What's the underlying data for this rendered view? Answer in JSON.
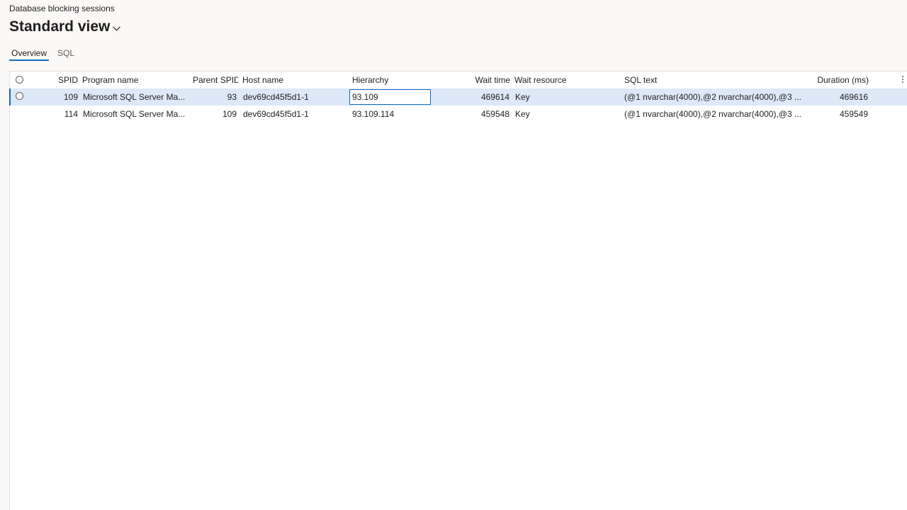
{
  "page": {
    "caption": "Database blocking sessions",
    "view_title": "Standard view"
  },
  "tabs": [
    {
      "label": "Overview",
      "active": true
    },
    {
      "label": "SQL",
      "active": false
    }
  ],
  "grid": {
    "columns": {
      "spid": "SPID",
      "program_name": "Program name",
      "parent_spid": "Parent SPID",
      "host_name": "Host name",
      "hierarchy": "Hierarchy",
      "wait_time": "Wait time",
      "wait_resource": "Wait resource",
      "sql_text": "SQL text",
      "duration": "Duration (ms)"
    },
    "rows": [
      {
        "selected": true,
        "spid": "109",
        "program_name": "Microsoft SQL Server Ma...",
        "parent_spid": "93",
        "host_name": "dev69cd45f5d1-1",
        "hierarchy": "93.109",
        "wait_time": "469614",
        "wait_resource": "Key",
        "sql_text": "(@1 nvarchar(4000),@2 nvarchar(4000),@3 ...",
        "duration": "469616"
      },
      {
        "selected": false,
        "spid": "114",
        "program_name": "Microsoft SQL Server Ma...",
        "parent_spid": "109",
        "host_name": "dev69cd45f5d1-1",
        "hierarchy": "93.109.114",
        "wait_time": "459548",
        "wait_resource": "Key",
        "sql_text": "(@1 nvarchar(4000),@2 nvarchar(4000),@3 ...",
        "duration": "459549"
      }
    ]
  },
  "icons": {
    "view_chevron": "chevron-down-icon",
    "column_options": "more-vertical-icon"
  },
  "colors": {
    "accent": "#0f6cbd",
    "selected_row": "#dde8f9",
    "background": "#faf9f8"
  }
}
